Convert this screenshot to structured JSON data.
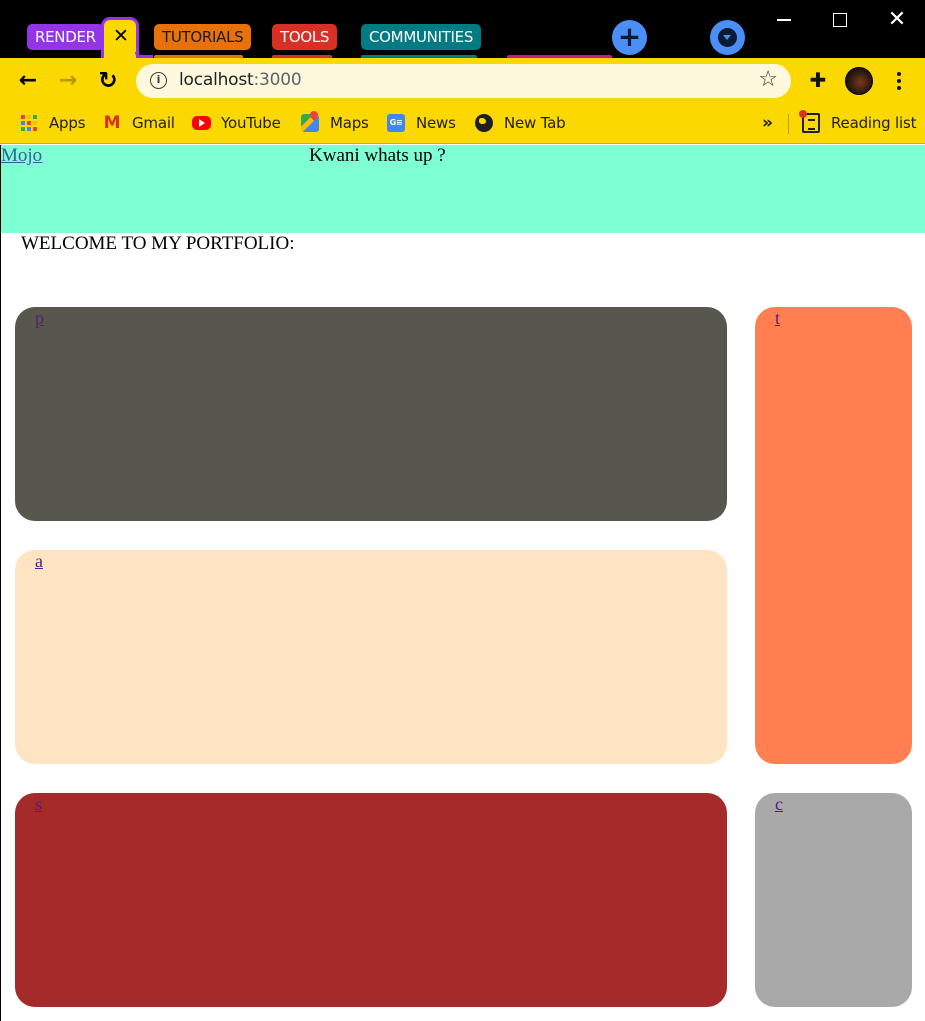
{
  "browser": {
    "tab_groups": [
      {
        "label": "RENDER",
        "color": "#9334e6"
      },
      {
        "label": "TUTORIALS",
        "color": "#e8710a"
      },
      {
        "label": "TOOLS",
        "color": "#d93025"
      },
      {
        "label": "COMMUNITIES",
        "color": "#007b83"
      }
    ],
    "collapsed_group_color": "#d01884",
    "active_tab_close_glyph": "✕",
    "new_tab_glyph": "+",
    "window_controls": {
      "minimize": "minimize-icon",
      "maximize": "maximize-icon",
      "close_glyph": "✕"
    },
    "address_bar": {
      "host": "localhost",
      "port": ":3000"
    },
    "toolbar_glyphs": {
      "back": "←",
      "forward": "→",
      "reload": "↻",
      "info": "i",
      "star": "☆",
      "extensions": "✚"
    },
    "bookmarks": [
      {
        "label": "Apps",
        "icon": "apps-grid-icon"
      },
      {
        "label": "Gmail",
        "icon": "gmail-icon"
      },
      {
        "label": "YouTube",
        "icon": "youtube-icon"
      },
      {
        "label": "Maps",
        "icon": "maps-icon"
      },
      {
        "label": "News",
        "icon": "news-icon"
      },
      {
        "label": "New Tab",
        "icon": "globe-icon"
      }
    ],
    "bookmarks_overflow_glyph": "»",
    "reading_list_label": "Reading list",
    "theme_color": "#fbd800"
  },
  "page": {
    "header": {
      "logo_link": "Mojo",
      "tagline": "Kwani whats up ?",
      "background": "#7fffd4"
    },
    "welcome": "WELCOME TO MY PORTFOLIO:",
    "cards": [
      {
        "id": "p",
        "link": "p",
        "color": "#58574d"
      },
      {
        "id": "t",
        "link": "t",
        "color": "#ff7f50"
      },
      {
        "id": "a",
        "link": "a",
        "color": "#ffe4c4"
      },
      {
        "id": "s",
        "link": "s",
        "color": "#a52a2a"
      },
      {
        "id": "c",
        "link": "c",
        "color": "#a9a9a9"
      }
    ]
  }
}
